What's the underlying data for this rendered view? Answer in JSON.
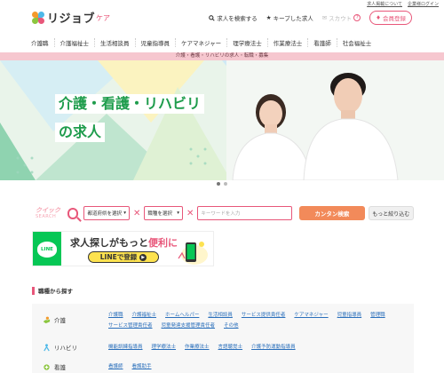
{
  "util_links": [
    "求人掲載について",
    "企業様ログイン"
  ],
  "logo": {
    "text": "リジョブ",
    "sub": "ケア"
  },
  "header_nav": {
    "search": "求人を検索する",
    "keep": "キープした求人",
    "scout": "スカウト",
    "help": "?",
    "register": "会員登録"
  },
  "categories": [
    "介護職",
    "介護福祉士",
    "生活相談員",
    "児童指導員",
    "ケアマネジャー",
    "理学療法士",
    "作業療法士",
    "看護師",
    "社会福祉士"
  ],
  "pink_strip": "介護・看護・リハビリの求人・転職・募集",
  "hero": {
    "line1": "介護・看護・リハビリ",
    "line2": "の求人"
  },
  "quick_search": {
    "label_top": "クイック",
    "label_bottom": "SEARCH",
    "area_select": "都道府県を選択",
    "job_select": "職種を選択",
    "keyword_placeholder": "キーワードを入力",
    "search_btn": "カンタン検索",
    "more_btn": "もっと絞り込む"
  },
  "line_banner": {
    "logo": "LINE",
    "title_pre": "求人探しがもっと",
    "title_hl": "便利に",
    "btn": "LINEで登録"
  },
  "section_title": "職種から探す",
  "job_types": [
    {
      "name": "介護",
      "links": [
        "介護職",
        "介護福祉士",
        "ホームヘルパー",
        "生活相談員",
        "サービス提供責任者",
        "ケアマネジャー",
        "児童指導員",
        "管理職",
        "サービス管理責任者",
        "児童発達支援管理責任者",
        "その他"
      ]
    },
    {
      "name": "リハビリ",
      "links": [
        "機能訓練指導員",
        "理学療法士",
        "作業療法士",
        "言語聴覚士",
        "介護予防運動指導員"
      ]
    },
    {
      "name": "看護",
      "links": [
        "看護師",
        "看護助手"
      ]
    }
  ]
}
